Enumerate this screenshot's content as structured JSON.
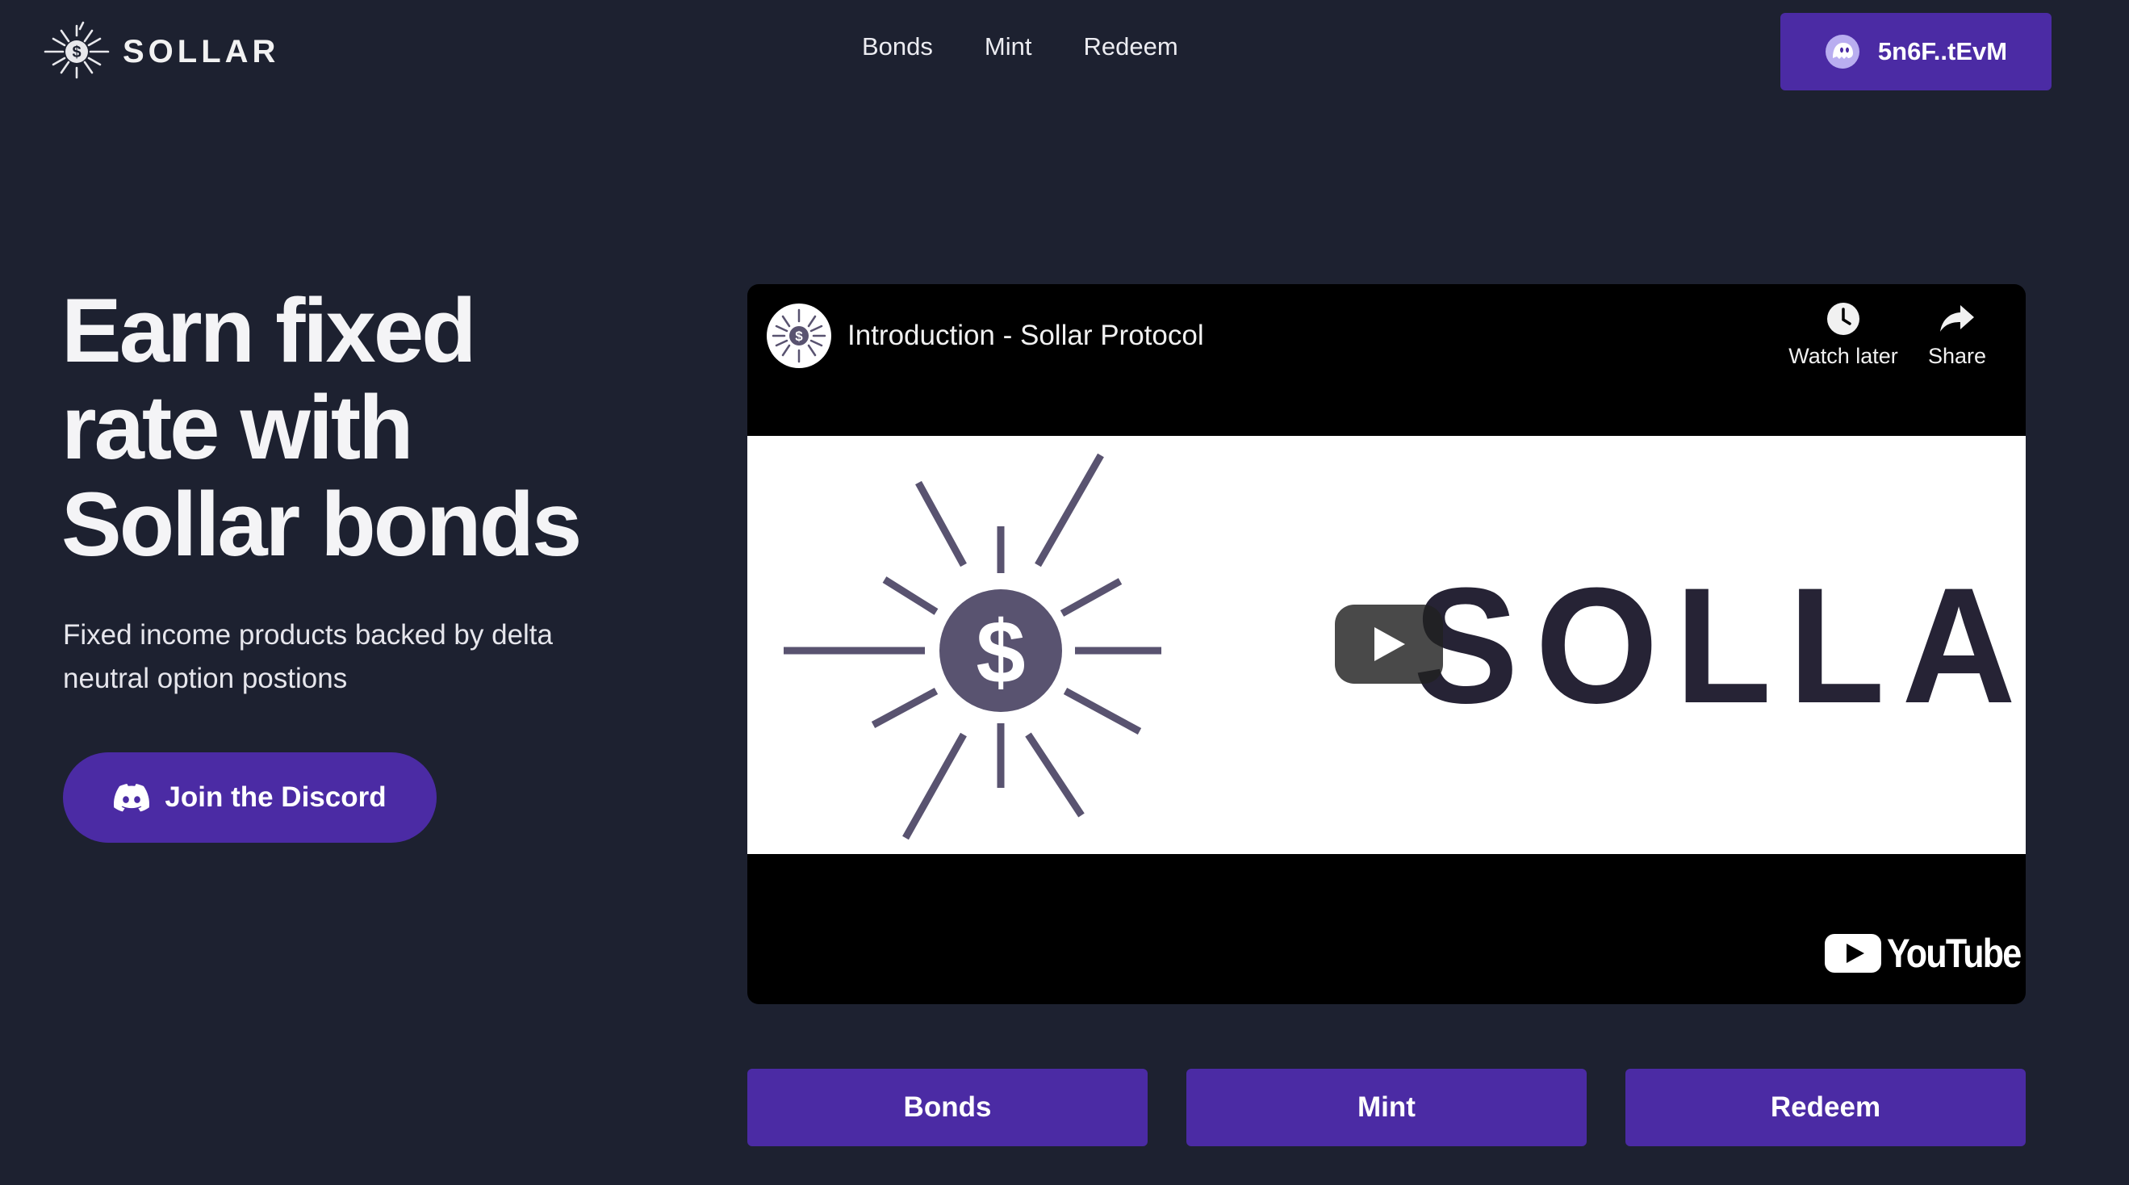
{
  "header": {
    "logo_text": "SOLLAR",
    "nav": [
      "Bonds",
      "Mint",
      "Redeem"
    ],
    "wallet_label": "5n6F..tEvM"
  },
  "hero": {
    "title_lines": [
      "Earn fixed",
      "rate with",
      "Sollar bonds"
    ],
    "subtitle": "Fixed income products backed by delta neutral option postions",
    "discord_label": "Join the Discord"
  },
  "video": {
    "title": "Introduction - Sollar Protocol",
    "watch_later_label": "Watch later",
    "share_label": "Share",
    "youtube_label": "YouTube",
    "thumbnail_wordmark": "SOLLAR",
    "icons": [
      "clock-icon",
      "share-icon",
      "play-icon",
      "youtube-logo-icon"
    ]
  },
  "actions": [
    "Bonds",
    "Mint",
    "Redeem"
  ],
  "colors": {
    "background": "#1d2130",
    "accent": "#4b2ba4",
    "logo_gray": "#595370",
    "wordmark_dark": "#262335"
  }
}
